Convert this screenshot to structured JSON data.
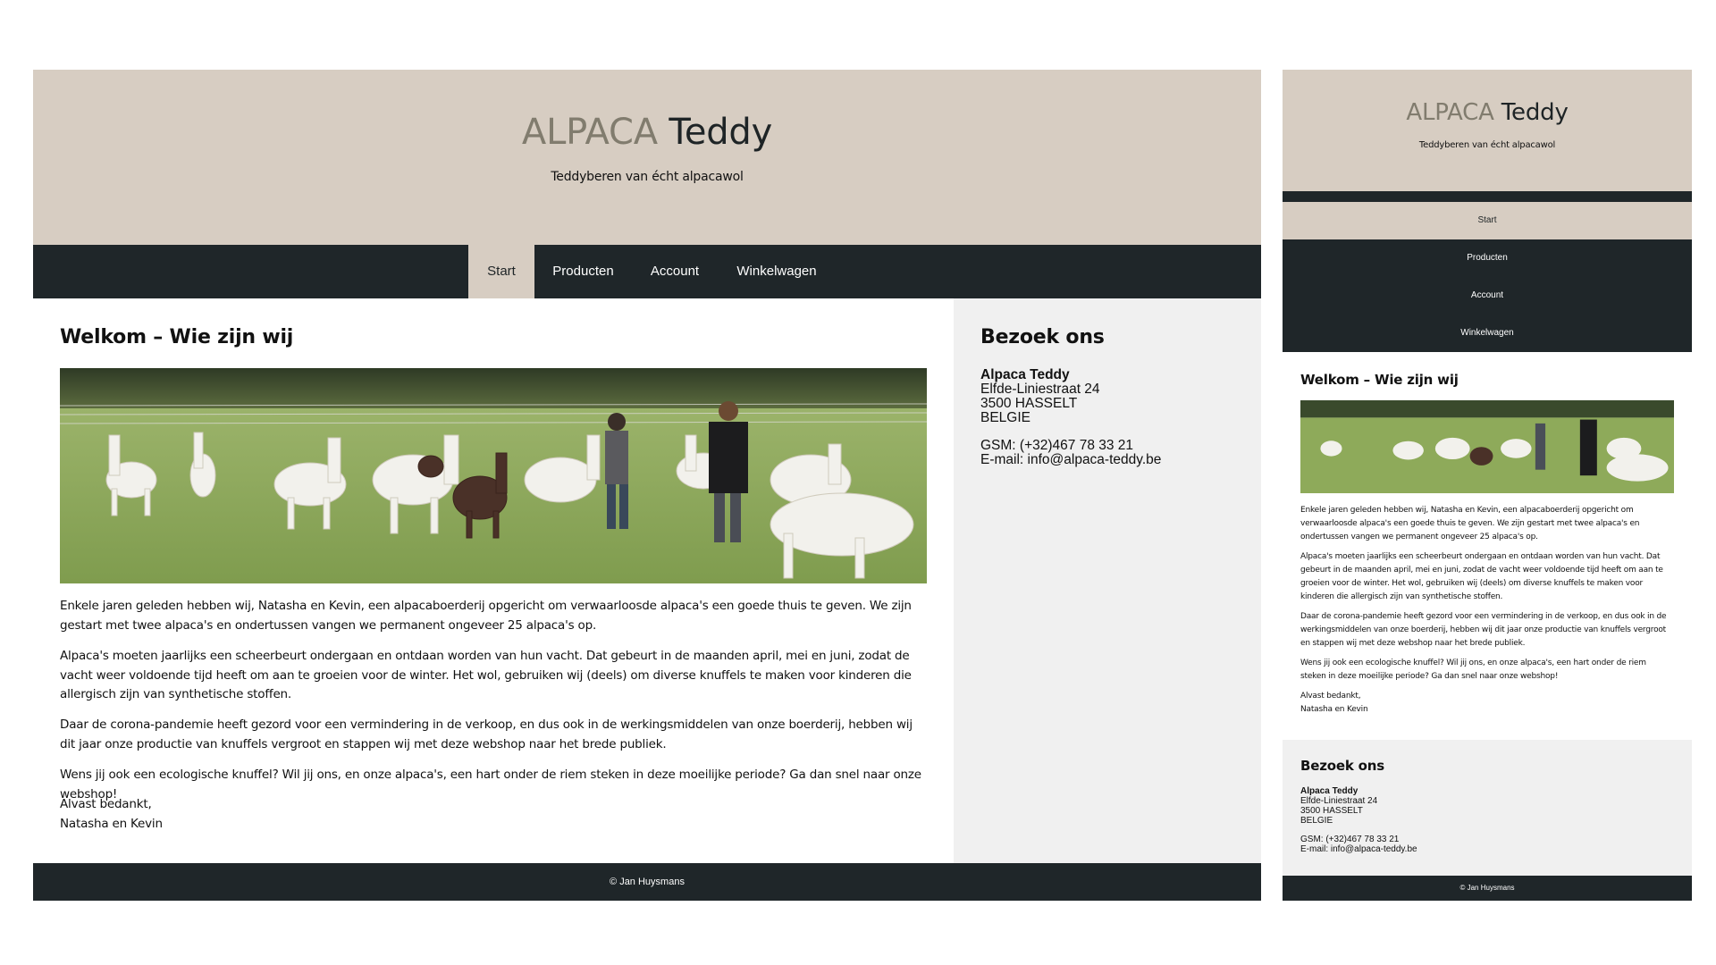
{
  "site": {
    "brand_part1": "ALPACA",
    "brand_part2": " Teddy",
    "tagline": "Teddyberen van écht alpacawol"
  },
  "nav": {
    "items": [
      "Start",
      "Producten",
      "Account",
      "Winkelwagen"
    ],
    "active": "Start"
  },
  "main": {
    "heading": "Welkom – Wie zijn wij",
    "photo_icon": "alpaca-photo",
    "paragraphs": [
      "Enkele jaren geleden hebben wij, Natasha en Kevin, een alpacaboerderij opgericht om verwaarloosde alpaca's een goede thuis te geven. We zijn gestart met twee alpaca's en ondertussen vangen we permanent ongeveer 25 alpaca's op.",
      "Alpaca's moeten jaarlijks een scheerbeurt ondergaan en ontdaan worden van hun vacht. Dat gebeurt in de maanden april, mei en juni, zodat de vacht weer voldoende tijd heeft om aan te groeien voor de winter. Het wol, gebruiken wij (deels) om diverse knuffels te maken voor kinderen die allergisch zijn van synthetische stoffen.",
      "Daar de corona-pandemie heeft gezord voor een vermindering in de verkoop, en dus ook in de werkingsmiddelen van onze boerderij, hebben wij dit jaar onze productie van knuffels vergroot en stappen wij met deze webshop naar het brede publiek.",
      "Wens jij ook een ecologische knuffel? Wil jij ons, en onze alpaca's, een hart onder de riem steken in deze moeilijke periode? Ga dan snel naar onze webshop!"
    ],
    "closing_line1": "Alvast bedankt,",
    "closing_line2": "Natasha en Kevin"
  },
  "aside": {
    "heading": "Bezoek ons",
    "name": "Alpaca Teddy",
    "street": "Elfde-Liniestraat 24",
    "city": "3500 HASSELT",
    "country": "BELGIE",
    "phone": "GSM: (+32)467 78 33 21",
    "email": "E-mail: info@alpaca-teddy.be"
  },
  "footer": {
    "text": "© Jan Huysmans"
  },
  "colors": {
    "header_bg": "#d7cdc2",
    "nav_bg": "#1f2629",
    "aside_bg": "#f0f0f0",
    "brand_accent": "#817c6e"
  }
}
